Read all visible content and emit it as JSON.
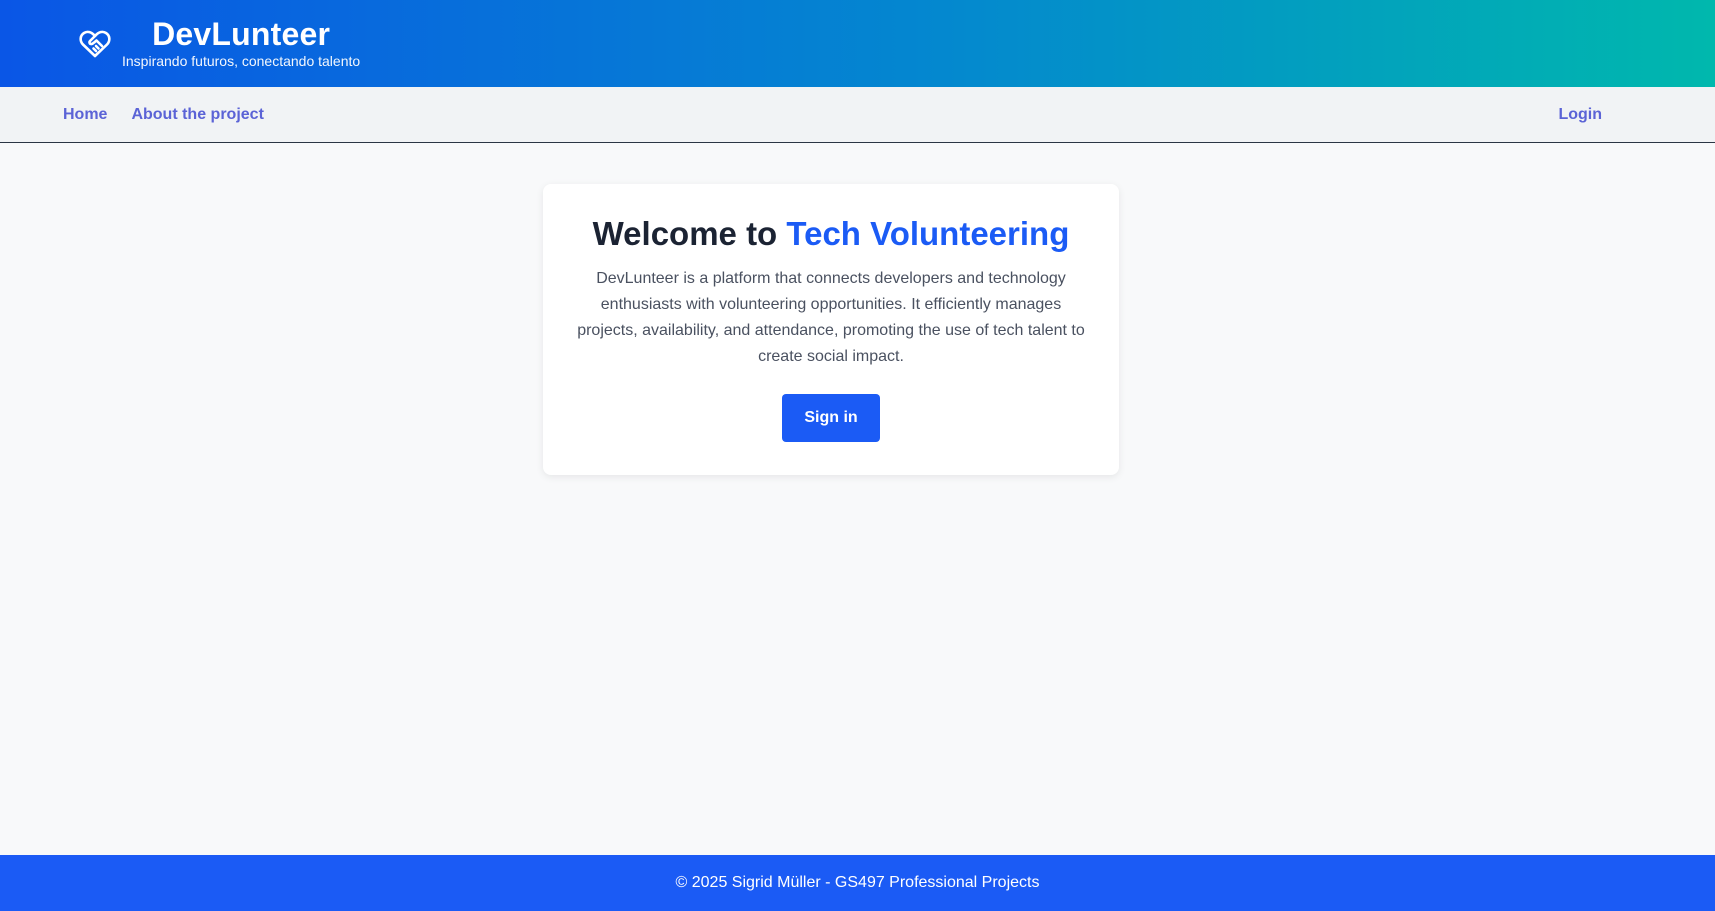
{
  "header": {
    "title": "DevLunteer",
    "tagline": "Inspirando futuros, conectando talento",
    "logo_icon": "heart-handshake-icon"
  },
  "nav": {
    "home": "Home",
    "about": "About the project",
    "login": "Login"
  },
  "hero": {
    "title_prefix": "Welcome to ",
    "title_accent": "Tech Volunteering",
    "description": "DevLunteer is a platform that connects developers and technology enthusiasts with volunteering opportunities. It efficiently manages projects, availability, and attendance, promoting the use of tech talent to create social impact.",
    "signin_label": "Sign in"
  },
  "footer": {
    "text": "© 2025 Sigrid Müller - GS497 Professional Projects"
  },
  "colors": {
    "accent": "#1b5bf5",
    "nav_link": "#5b63d6",
    "header_gradient_start": "#0a56e6",
    "header_gradient_end": "#00b8ad"
  }
}
